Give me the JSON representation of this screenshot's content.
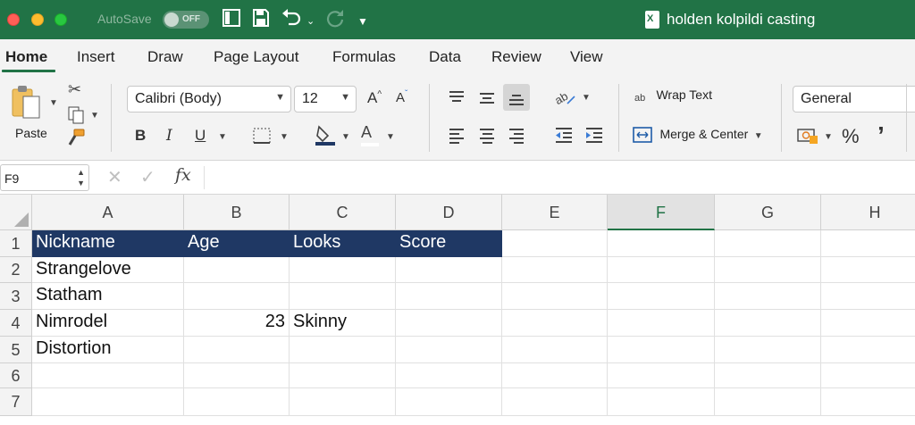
{
  "titlebar": {
    "autosave_label": "AutoSave",
    "toggle_state": "OFF",
    "doc_title": "holden kolpildi casting",
    "doc_icon_letter": "X",
    "color": "#217346"
  },
  "tabs": [
    "Home",
    "Insert",
    "Draw",
    "Page Layout",
    "Formulas",
    "Data",
    "Review",
    "View"
  ],
  "active_tab": "Home",
  "ribbon": {
    "paste_label": "Paste",
    "font_name": "Calibri (Body)",
    "font_size": "12",
    "bold": "B",
    "italic": "I",
    "underline": "U",
    "font_color_glyph": "A",
    "grow_font": "A",
    "shrink_font": "A",
    "wrap_text": "Wrap Text",
    "wrap_icon_text": "ab",
    "merge_center": "Merge & Center",
    "number_format": "General",
    "percent": "%",
    "comma": "’"
  },
  "formula_bar": {
    "name_box": "F9",
    "fx": "fx",
    "value": ""
  },
  "grid": {
    "columns": [
      "A",
      "B",
      "C",
      "D",
      "E",
      "F",
      "G",
      "H"
    ],
    "selected_column": "F",
    "rows": [
      "1",
      "2",
      "3",
      "4",
      "5",
      "6",
      "7"
    ],
    "cells": {
      "A1": "Nickname",
      "B1": "Age",
      "C1": "Looks",
      "D1": "Score",
      "A2": "Strangelove",
      "A3": "Statham",
      "A4": "Nimrodel",
      "B4": "23",
      "C4": "Skinny",
      "A5": "Distortion"
    },
    "header_fill": "#1f3864"
  }
}
